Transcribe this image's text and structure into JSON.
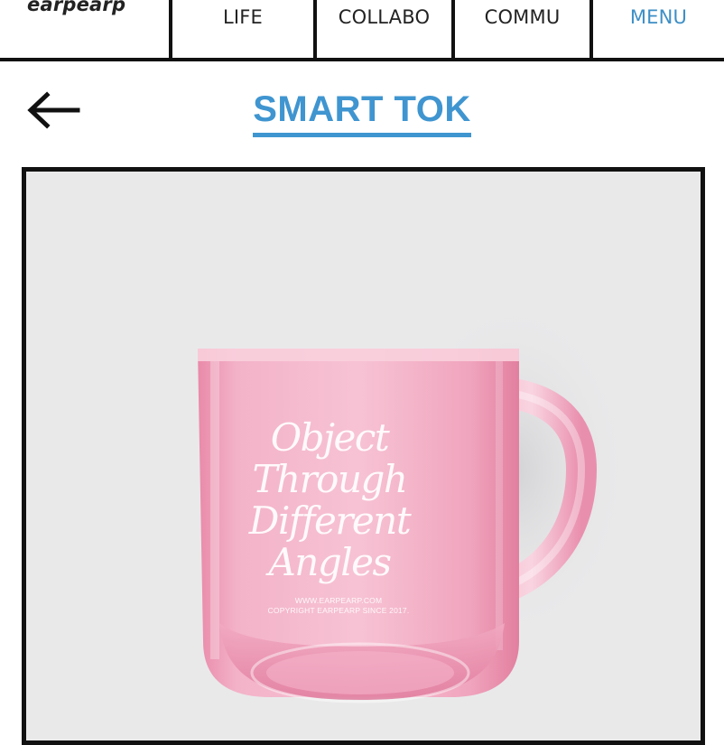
{
  "brand": {
    "logo_text": "earpearp"
  },
  "nav": {
    "items": [
      {
        "label": "LIFE"
      },
      {
        "label": "COLLABO"
      },
      {
        "label": "COMMU"
      },
      {
        "label": "MENU"
      }
    ]
  },
  "header": {
    "title": "SMART TOK",
    "back_icon": "left-arrow-icon"
  },
  "product": {
    "mug_text_lines": [
      "Object",
      "Through",
      "Different",
      "Angles"
    ],
    "mug_url": "WWW.EARPEARP.COM",
    "mug_copyright": "COPYRIGHT EARPEARP SINCE 2017."
  },
  "colors": {
    "accent": "#3f95d0",
    "mug_pink": "#f0a6c0",
    "background_gray": "#e9e9ea"
  }
}
